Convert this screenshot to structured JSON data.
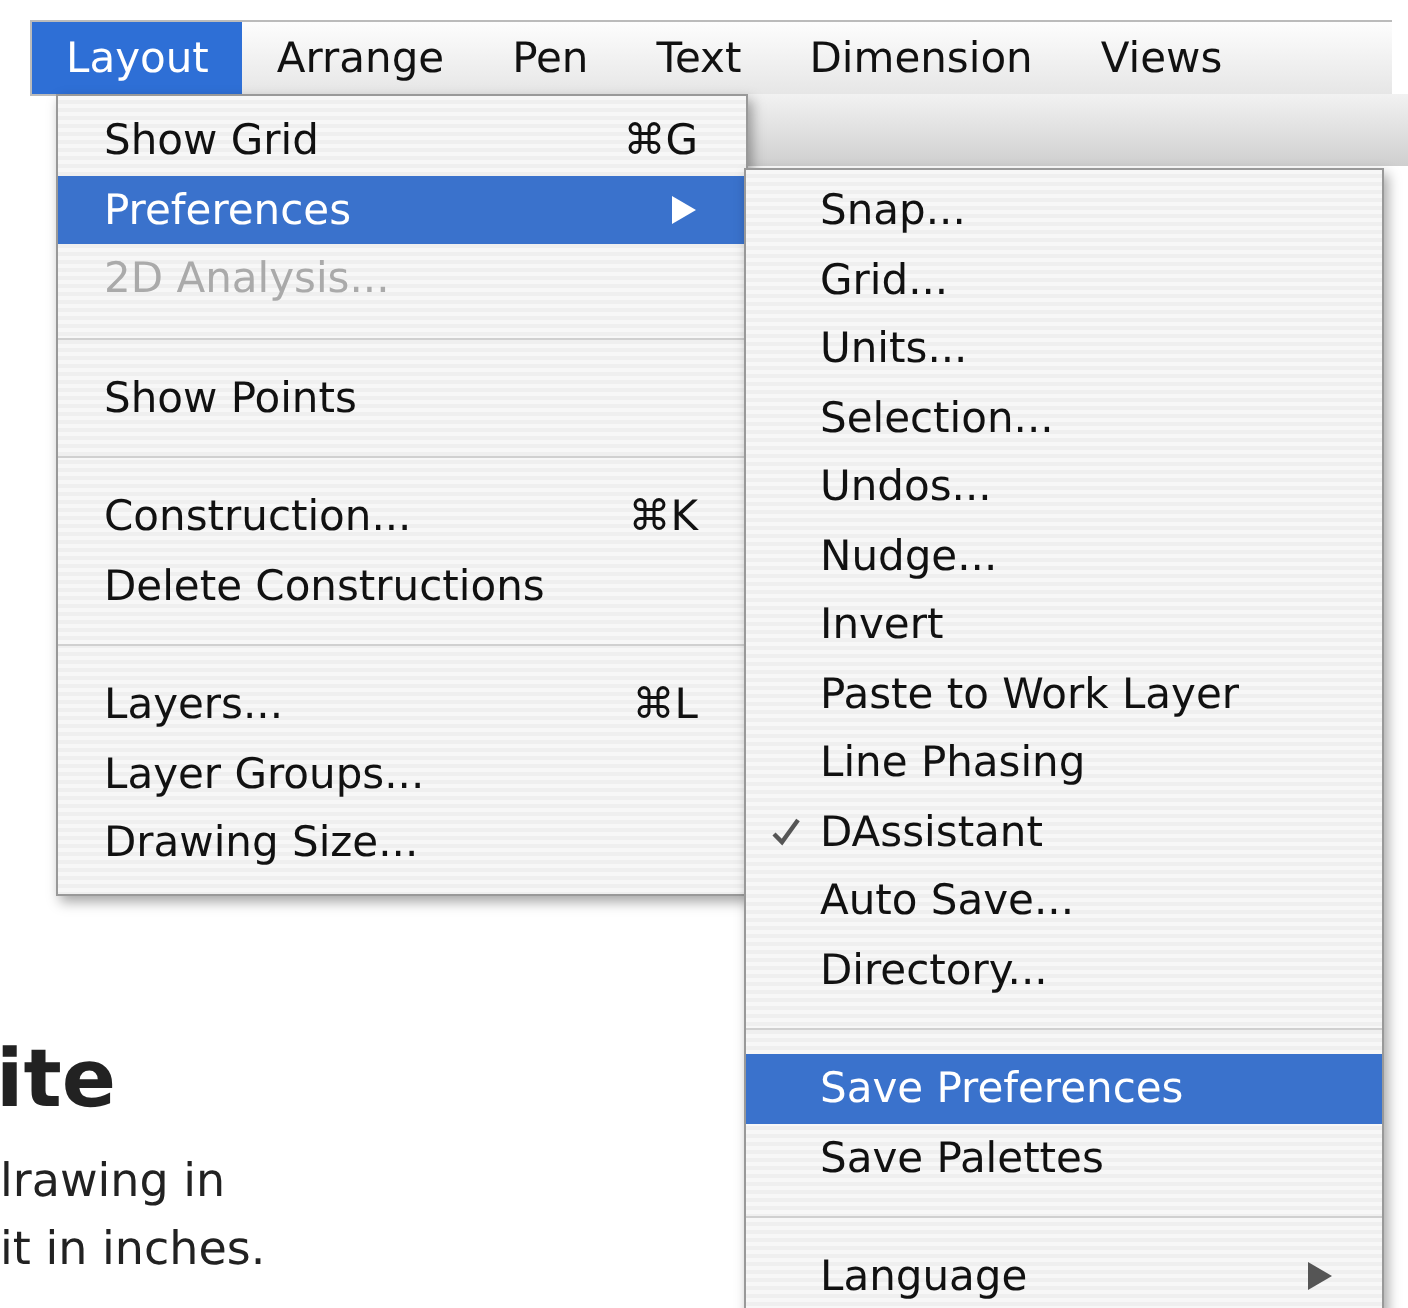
{
  "menu_bar": [
    {
      "label": "Layout",
      "selected": true
    },
    {
      "label": "Arrange",
      "selected": false
    },
    {
      "label": "Pen",
      "selected": false
    },
    {
      "label": "Text",
      "selected": false
    },
    {
      "label": "Dimension",
      "selected": false
    },
    {
      "label": "Views",
      "selected": false
    }
  ],
  "menu": [
    {
      "kind": "item",
      "label": "Show Grid",
      "shortcut": "⌘G",
      "selected": false,
      "disabled": false,
      "submenu": false
    },
    {
      "kind": "item",
      "label": "Preferences",
      "selected": true,
      "disabled": false,
      "submenu": true
    },
    {
      "kind": "item",
      "label": "2D Analysis...",
      "selected": false,
      "disabled": true,
      "submenu": false
    },
    {
      "kind": "separator"
    },
    {
      "kind": "item",
      "label": "Show Points",
      "selected": false,
      "disabled": false,
      "submenu": false
    },
    {
      "kind": "separator"
    },
    {
      "kind": "item",
      "label": "Construction...",
      "shortcut": "⌘K",
      "selected": false,
      "disabled": false,
      "submenu": false
    },
    {
      "kind": "item",
      "label": "Delete Constructions",
      "selected": false,
      "disabled": false,
      "submenu": false
    },
    {
      "kind": "separator"
    },
    {
      "kind": "item",
      "label": "Layers...",
      "shortcut": "⌘L",
      "selected": false,
      "disabled": false,
      "submenu": false
    },
    {
      "kind": "item",
      "label": "Layer Groups...",
      "selected": false,
      "disabled": false,
      "submenu": false
    },
    {
      "kind": "item",
      "label": "Drawing Size...",
      "selected": false,
      "disabled": false,
      "submenu": false
    }
  ],
  "submenu": [
    {
      "kind": "item",
      "label": "Snap...",
      "selected": false,
      "checked": false,
      "submenu": false
    },
    {
      "kind": "item",
      "label": "Grid...",
      "selected": false,
      "checked": false,
      "submenu": false
    },
    {
      "kind": "item",
      "label": "Units...",
      "selected": false,
      "checked": false,
      "submenu": false
    },
    {
      "kind": "item",
      "label": "Selection...",
      "selected": false,
      "checked": false,
      "submenu": false
    },
    {
      "kind": "item",
      "label": "Undos...",
      "selected": false,
      "checked": false,
      "submenu": false
    },
    {
      "kind": "item",
      "label": "Nudge...",
      "selected": false,
      "checked": false,
      "submenu": false
    },
    {
      "kind": "item",
      "label": "Invert",
      "selected": false,
      "checked": false,
      "submenu": false
    },
    {
      "kind": "item",
      "label": "Paste to Work Layer",
      "selected": false,
      "checked": false,
      "submenu": false
    },
    {
      "kind": "item",
      "label": "Line Phasing",
      "selected": false,
      "checked": false,
      "submenu": false
    },
    {
      "kind": "item",
      "label": "DAssistant",
      "selected": false,
      "checked": true,
      "submenu": false
    },
    {
      "kind": "item",
      "label": "Auto Save...",
      "selected": false,
      "checked": false,
      "submenu": false
    },
    {
      "kind": "item",
      "label": "Directory...",
      "selected": false,
      "checked": false,
      "submenu": false
    },
    {
      "kind": "separator"
    },
    {
      "kind": "item",
      "label": "Save Preferences",
      "selected": true,
      "checked": false,
      "submenu": false
    },
    {
      "kind": "item",
      "label": "Save Palettes",
      "selected": false,
      "checked": false,
      "submenu": false
    },
    {
      "kind": "separator"
    },
    {
      "kind": "item",
      "label": "Language",
      "selected": false,
      "checked": false,
      "submenu": true
    }
  ],
  "page": {
    "heading": "ite",
    "lines": [
      "lrawing in",
      "it in inches."
    ]
  }
}
